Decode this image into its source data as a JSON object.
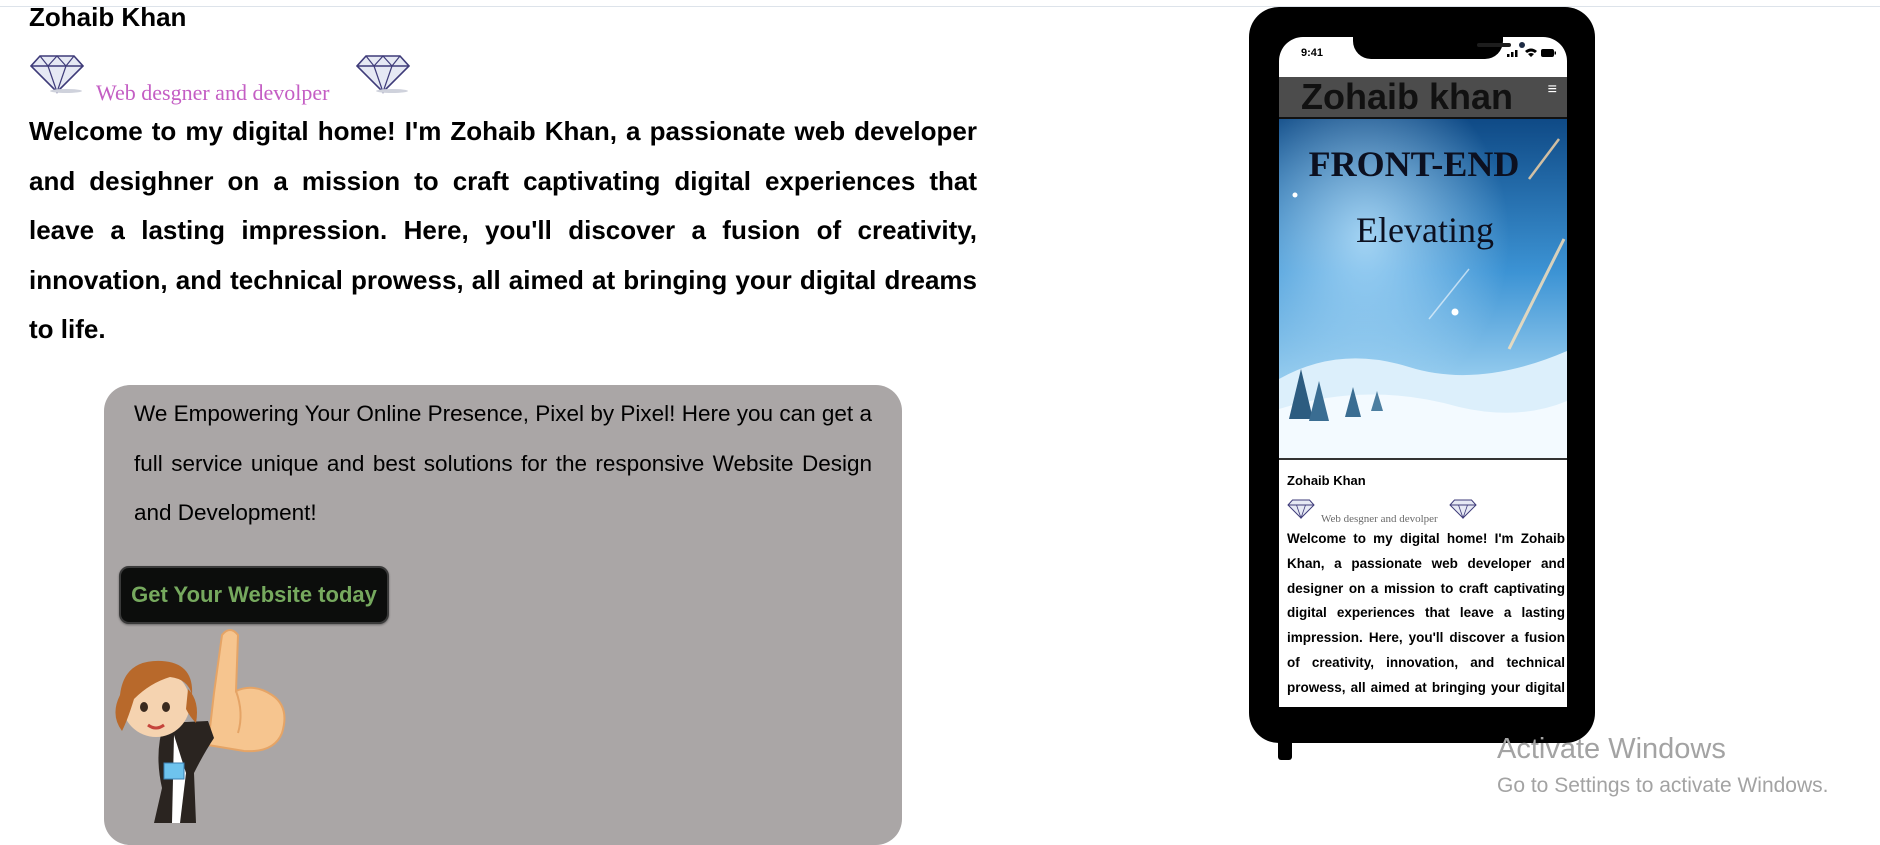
{
  "page": {
    "name": "Zohaib Khan",
    "role": "Web desgner and devolper",
    "intro": "Welcome to my digital home! I'm Zohaib Khan, a passionate web developer and desighner on a mission to craft captivating digital experiences that leave a lasting impression. Here, you'll discover a fusion of creativity, innovation, and technical prowess, all aimed at bringing your digital dreams to life."
  },
  "panel": {
    "text": "We Empowering Your Online Presence, Pixel by Pixel! Here you can get a full service unique and best solutions for the responsive Website Design and Development!",
    "cta_label": "Get Your Website today"
  },
  "phone": {
    "status_time": "9:41",
    "nav_title": "Zohaib khan",
    "menu_icon": "hamburger-icon",
    "hero_title": "FRONT-END",
    "hero_subtitle": "Elevating",
    "name": "Zohaib Khan",
    "role": "Web desgner and devolper",
    "intro": "Welcome to my digital home! I'm Zohaib Khan, a passionate web developer and designer on a mission to craft captivating digital experiences that leave a lasting impression. Here, you'll discover a fusion of creativity, innovation, and technical prowess, all aimed at bringing your digital dreams to life."
  },
  "watermark": {
    "line1": "Activate Windows",
    "line2": "Go to Settings to activate Windows."
  },
  "colors": {
    "role_text": "#c45ec4",
    "panel_bg": "#aaa6a6",
    "cta_text": "#76a95e",
    "cta_bg": "#0c0d0c"
  }
}
